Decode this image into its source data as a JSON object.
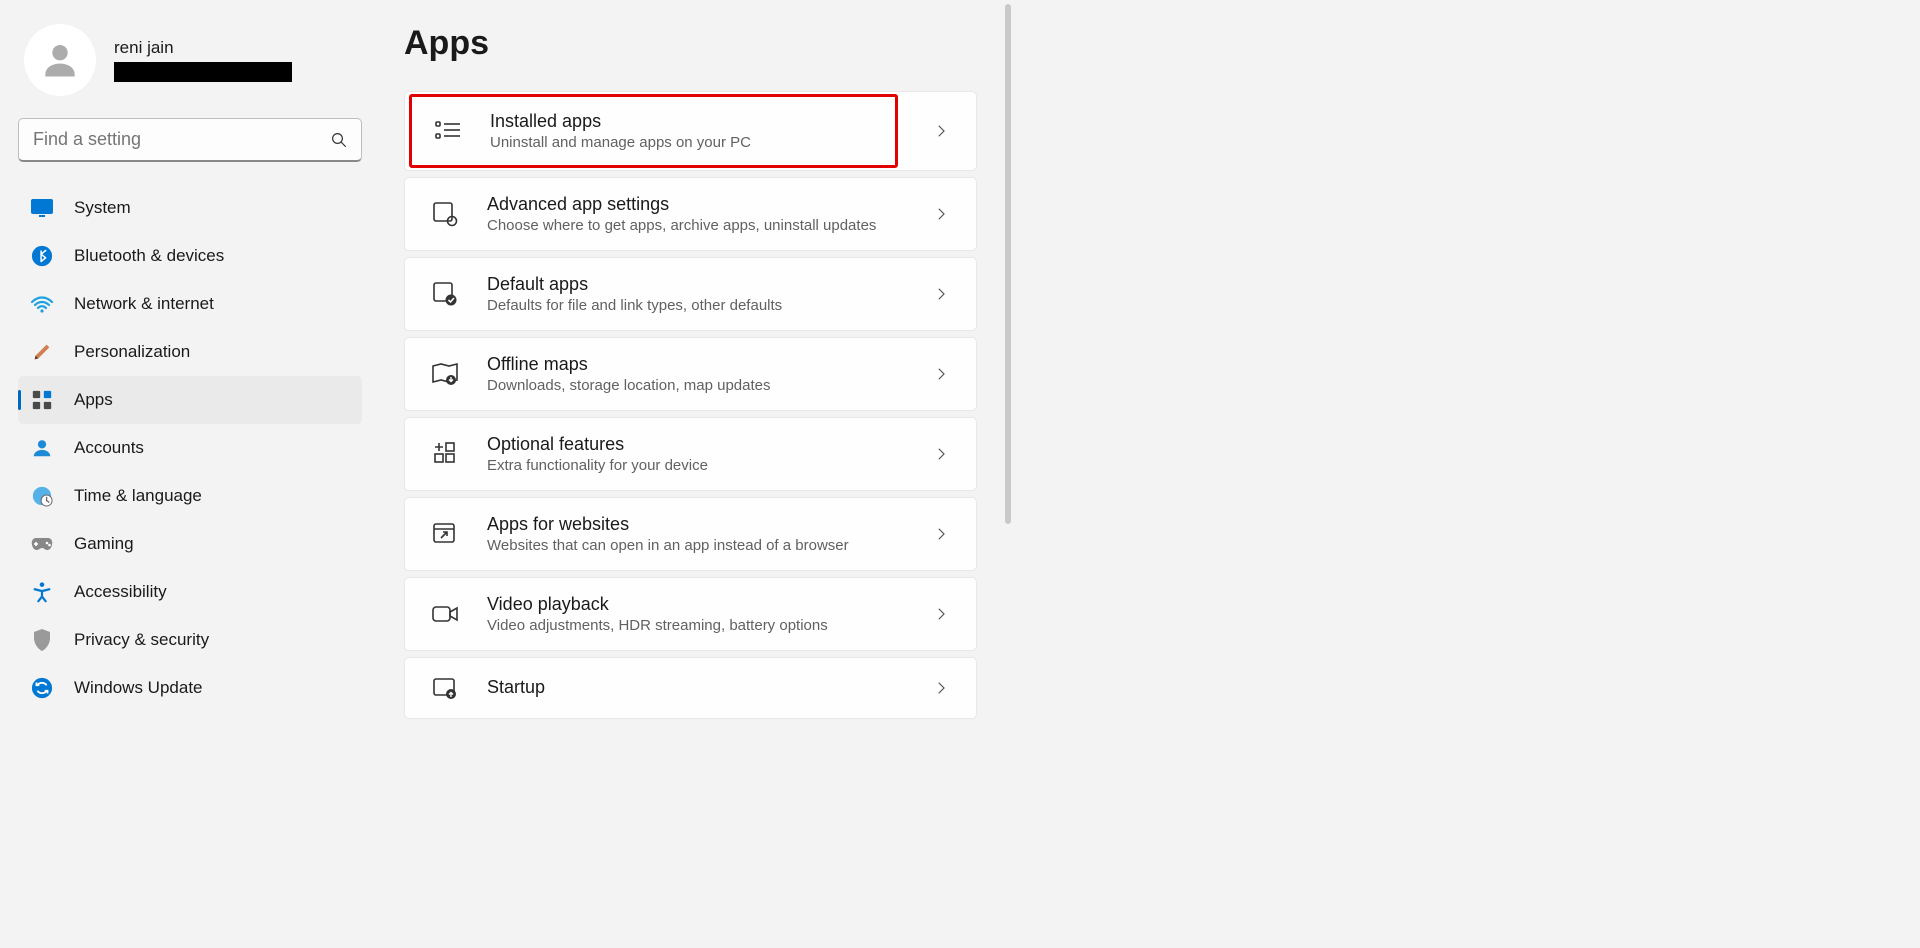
{
  "profile": {
    "name": "reni jain"
  },
  "search": {
    "placeholder": "Find a setting"
  },
  "nav": [
    {
      "label": "System"
    },
    {
      "label": "Bluetooth & devices"
    },
    {
      "label": "Network & internet"
    },
    {
      "label": "Personalization"
    },
    {
      "label": "Apps"
    },
    {
      "label": "Accounts"
    },
    {
      "label": "Time & language"
    },
    {
      "label": "Gaming"
    },
    {
      "label": "Accessibility"
    },
    {
      "label": "Privacy & security"
    },
    {
      "label": "Windows Update"
    }
  ],
  "page": {
    "title": "Apps"
  },
  "cards": [
    {
      "title": "Installed apps",
      "sub": "Uninstall and manage apps on your PC"
    },
    {
      "title": "Advanced app settings",
      "sub": "Choose where to get apps, archive apps, uninstall updates"
    },
    {
      "title": "Default apps",
      "sub": "Defaults for file and link types, other defaults"
    },
    {
      "title": "Offline maps",
      "sub": "Downloads, storage location, map updates"
    },
    {
      "title": "Optional features",
      "sub": "Extra functionality for your device"
    },
    {
      "title": "Apps for websites",
      "sub": "Websites that can open in an app instead of a browser"
    },
    {
      "title": "Video playback",
      "sub": "Video adjustments, HDR streaming, battery options"
    },
    {
      "title": "Startup",
      "sub": ""
    }
  ]
}
